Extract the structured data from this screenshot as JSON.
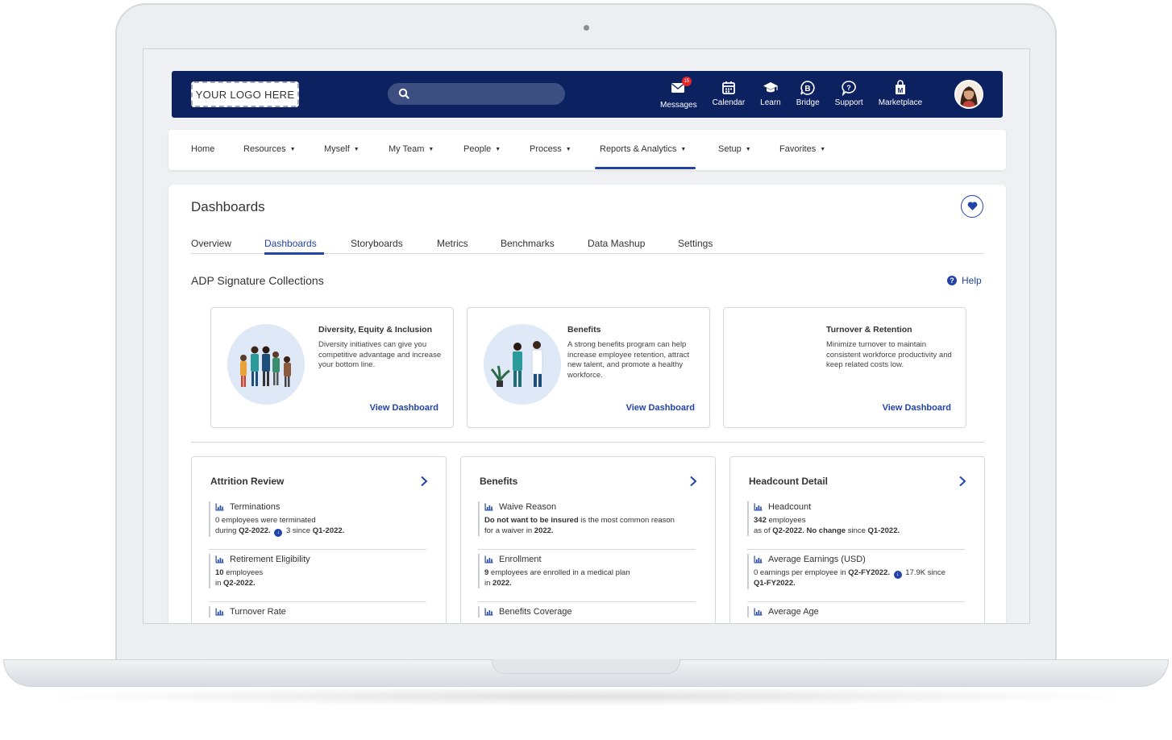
{
  "topbar": {
    "logo_text": "YOUR LOGO HERE",
    "search_placeholder": "",
    "message_count": "15",
    "items": [
      {
        "label": "Messages",
        "icon": "mail-icon"
      },
      {
        "label": "Calendar",
        "icon": "calendar-icon"
      },
      {
        "label": "Learn",
        "icon": "graduation-cap-icon"
      },
      {
        "label": "Bridge",
        "icon": "bridge-chat-icon"
      },
      {
        "label": "Support",
        "icon": "question-bubble-icon"
      },
      {
        "label": "Marketplace",
        "icon": "marketplace-bag-icon"
      }
    ]
  },
  "nav": {
    "items": [
      "Home",
      "Resources",
      "Myself",
      "My Team",
      "People",
      "Process",
      "Reports & Analytics",
      "Setup",
      "Favorites"
    ],
    "active": "Reports & Analytics"
  },
  "page": {
    "title": "Dashboards",
    "tabs": [
      "Overview",
      "Dashboards",
      "Storyboards",
      "Metrics",
      "Benchmarks",
      "Data Mashup",
      "Settings"
    ],
    "active_tab": "Dashboards",
    "section_title": "ADP Signature Collections",
    "help_label": "Help"
  },
  "collections": [
    {
      "title": "Diversity, Equity & Inclusion",
      "desc": "Diversity initiatives can give you competitive advantage and increase your bottom line.",
      "link": "View Dashboard"
    },
    {
      "title": "Benefits",
      "desc": "A strong benefits program can help increase employee retention, attract new talent, and promote a healthy workforce.",
      "link": "View Dashboard"
    },
    {
      "title": "Turnover & Retention",
      "desc": "Minimize turnover to maintain consistent workforce productivity and keep related costs low.",
      "link": "View Dashboard"
    }
  ],
  "metric_cards": [
    {
      "title": "Attrition Review",
      "items": [
        {
          "name": "Terminations",
          "l1a": "0",
          "l1b": " employees were terminated",
          "l2a": "during ",
          "l2b": "Q2-2022.",
          "l2c": " 3 since ",
          "l2d": "Q1-2022."
        },
        {
          "name": "Retirement Eligibility",
          "l1a": "10",
          "l1b": " employees",
          "l2a": "in ",
          "l2b": "Q2-2022.",
          "l2c": "",
          "l2d": ""
        },
        {
          "name": "Turnover Rate"
        }
      ]
    },
    {
      "title": "Benefits",
      "items": [
        {
          "name": "Waive Reason",
          "l1a": "Do not want to be insured",
          "l1b": " is the most common reason",
          "l2a": "for a waiver in ",
          "l2b": "2022.",
          "l2c": "",
          "l2d": ""
        },
        {
          "name": "Enrollment",
          "l1a": "9",
          "l1b": " employees are enrolled in a medical plan",
          "l2a": "in ",
          "l2b": "2022.",
          "l2c": "",
          "l2d": ""
        },
        {
          "name": "Benefits Coverage"
        }
      ]
    },
    {
      "title": "Headcount Detail",
      "items": [
        {
          "name": "Headcount",
          "l1a": "342",
          "l1b": " employees",
          "l2a": "as of ",
          "l2b": "Q2-2022. No change",
          "l2c": " since ",
          "l2d": "Q1-2022."
        },
        {
          "name": "Average Earnings (USD)",
          "l1a": "0",
          "l1b": " earnings per employee in ",
          "l1c": "Q2-FY2022.",
          "l1d": " 17.9K since",
          "l2a": "",
          "l2b": "Q1-FY2022.",
          "l2c": "",
          "l2d": ""
        },
        {
          "name": "Average Age"
        }
      ]
    }
  ],
  "colors": {
    "topbar": "#0c2160",
    "accent": "#2244a8",
    "badge": "#e3262a"
  }
}
